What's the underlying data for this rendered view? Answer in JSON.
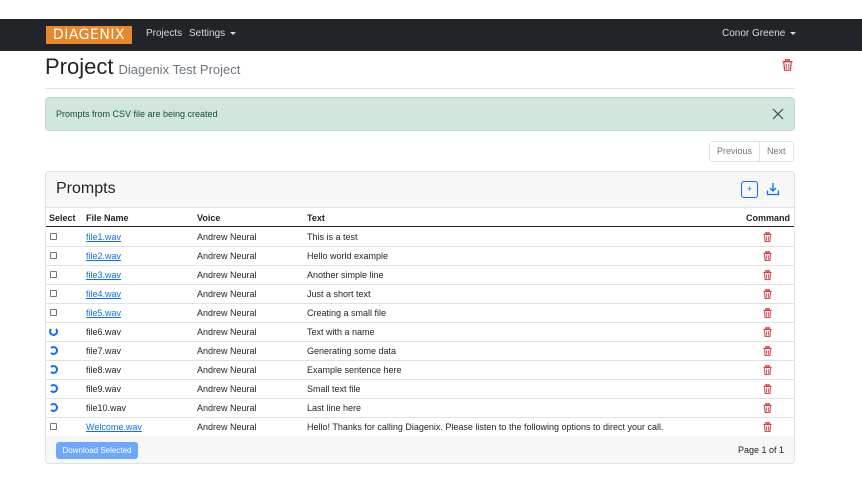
{
  "navbar": {
    "logo_text": "DIAGENIX",
    "projects": "Projects",
    "settings": "Settings",
    "user": "Conor Greene"
  },
  "header": {
    "title": "Project",
    "subtitle": "Diagenix Test Project"
  },
  "alert": {
    "message": "Prompts from CSV file are being created"
  },
  "pager": {
    "previous": "Previous",
    "next": "Next"
  },
  "prompts": {
    "title": "Prompts",
    "add_label": "+",
    "columns": [
      "Select",
      "File Name",
      "Voice",
      "Text",
      "Command"
    ],
    "rows": [
      {
        "status": "checkbox",
        "file": "file1.wav",
        "linked": true,
        "voice": "Andrew Neural",
        "text": "This is a test"
      },
      {
        "status": "checkbox",
        "file": "file2.wav",
        "linked": true,
        "voice": "Andrew Neural",
        "text": "Hello world example"
      },
      {
        "status": "checkbox",
        "file": "file3.wav",
        "linked": true,
        "voice": "Andrew Neural",
        "text": "Another simple line"
      },
      {
        "status": "checkbox",
        "file": "file4.wav",
        "linked": true,
        "voice": "Andrew Neural",
        "text": "Just a short text"
      },
      {
        "status": "checkbox",
        "file": "file5.wav",
        "linked": true,
        "voice": "Andrew Neural",
        "text": "Creating a small file"
      },
      {
        "status": "spinner",
        "file": "file6.wav",
        "linked": false,
        "voice": "Andrew Neural",
        "text": "Text with a name"
      },
      {
        "status": "spinner",
        "file": "file7.wav",
        "linked": false,
        "voice": "Andrew Neural",
        "text": "Generating some data"
      },
      {
        "status": "spinner",
        "file": "file8.wav",
        "linked": false,
        "voice": "Andrew Neural",
        "text": "Example sentence here"
      },
      {
        "status": "spinner",
        "file": "file9.wav",
        "linked": false,
        "voice": "Andrew Neural",
        "text": "Small text file"
      },
      {
        "status": "spinner",
        "file": "file10.wav",
        "linked": false,
        "voice": "Andrew Neural",
        "text": "Last line here"
      },
      {
        "status": "checkbox",
        "file": "Welcome.wav",
        "linked": true,
        "voice": "Andrew Neural",
        "text": "Hello! Thanks for calling Diagenix. Please listen to the following options to direct your call."
      }
    ],
    "download_selected": "Download Selected",
    "page_count": "Page 1 of 1"
  },
  "colors": {
    "navbar": "#212529",
    "logo": "#e8882a",
    "alert_bg": "#d1e7dd",
    "alert_text": "#0f5132",
    "link": "#0d6efd",
    "danger": "#dc3545",
    "button": "#6ea8fe"
  },
  "icons": {
    "delete": "trash-icon",
    "close": "close-icon",
    "download": "download-icon",
    "loading": "spinner-icon"
  }
}
